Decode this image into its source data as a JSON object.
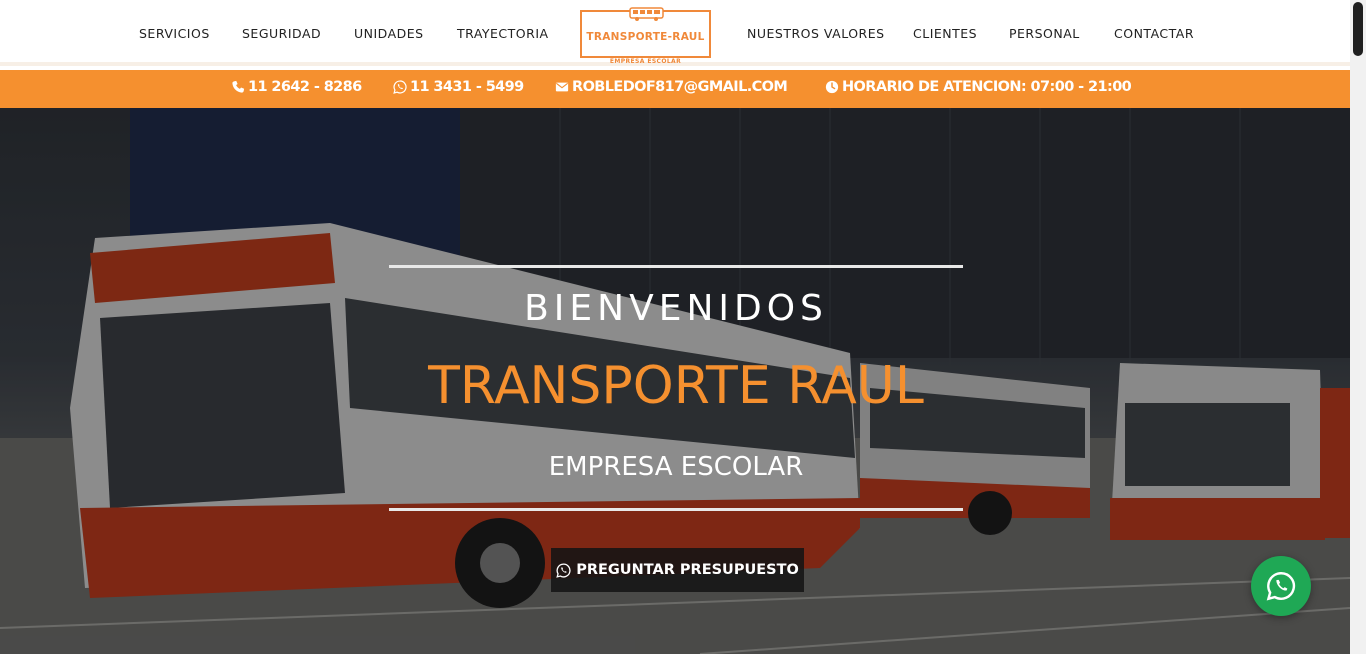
{
  "nav": {
    "items": [
      {
        "label": "SERVICIOS"
      },
      {
        "label": "SEGURIDAD"
      },
      {
        "label": "UNIDADES"
      },
      {
        "label": "TRAYECTORIA"
      },
      {
        "label": "NUESTROS VALORES"
      },
      {
        "label": "CLIENTES"
      },
      {
        "label": "PERSONAL"
      },
      {
        "label": "CONTACTAR"
      }
    ]
  },
  "logo": {
    "title": "TRANSPORTE-RAUL",
    "subtitle": "EMPRESA ESCOLAR",
    "icon": "bus-icon"
  },
  "infobar": {
    "phone": {
      "icon": "phone-icon",
      "text": "11 2642 - 8286"
    },
    "whatsapp": {
      "icon": "whatsapp-icon",
      "text": "11 3431 - 5499"
    },
    "email": {
      "icon": "envelope-icon",
      "text": "ROBLEDOF817@GMAIL.COM"
    },
    "hours": {
      "icon": "clock-icon",
      "text": "HORARIO DE ATENCION: 07:00 - 21:00"
    }
  },
  "hero": {
    "welcome": "BIENVENIDOS",
    "title": "TRANSPORTE RAUL",
    "subtitle": "EMPRESA ESCOLAR",
    "cta": {
      "icon": "whatsapp-icon",
      "label": "PREGUNTAR PRESUPUESTO"
    }
  },
  "floating_whatsapp": {
    "icon": "whatsapp-icon"
  },
  "colors": {
    "accent": "#f5902f",
    "whatsapp_green": "#1fa855",
    "nav_text": "#222222"
  }
}
